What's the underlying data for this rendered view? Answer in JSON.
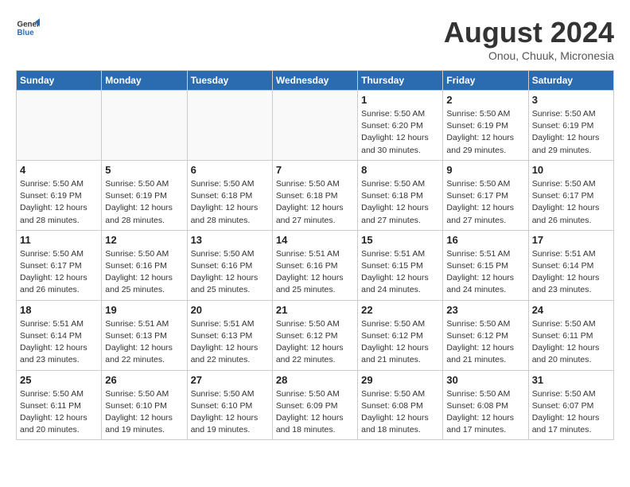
{
  "header": {
    "logo_line1": "General",
    "logo_line2": "Blue",
    "month_year": "August 2024",
    "location": "Onou, Chuuk, Micronesia"
  },
  "weekdays": [
    "Sunday",
    "Monday",
    "Tuesday",
    "Wednesday",
    "Thursday",
    "Friday",
    "Saturday"
  ],
  "weeks": [
    [
      {
        "day": "",
        "info": ""
      },
      {
        "day": "",
        "info": ""
      },
      {
        "day": "",
        "info": ""
      },
      {
        "day": "",
        "info": ""
      },
      {
        "day": "1",
        "info": "Sunrise: 5:50 AM\nSunset: 6:20 PM\nDaylight: 12 hours and 30 minutes."
      },
      {
        "day": "2",
        "info": "Sunrise: 5:50 AM\nSunset: 6:19 PM\nDaylight: 12 hours and 29 minutes."
      },
      {
        "day": "3",
        "info": "Sunrise: 5:50 AM\nSunset: 6:19 PM\nDaylight: 12 hours and 29 minutes."
      }
    ],
    [
      {
        "day": "4",
        "info": "Sunrise: 5:50 AM\nSunset: 6:19 PM\nDaylight: 12 hours and 28 minutes."
      },
      {
        "day": "5",
        "info": "Sunrise: 5:50 AM\nSunset: 6:19 PM\nDaylight: 12 hours and 28 minutes."
      },
      {
        "day": "6",
        "info": "Sunrise: 5:50 AM\nSunset: 6:18 PM\nDaylight: 12 hours and 28 minutes."
      },
      {
        "day": "7",
        "info": "Sunrise: 5:50 AM\nSunset: 6:18 PM\nDaylight: 12 hours and 27 minutes."
      },
      {
        "day": "8",
        "info": "Sunrise: 5:50 AM\nSunset: 6:18 PM\nDaylight: 12 hours and 27 minutes."
      },
      {
        "day": "9",
        "info": "Sunrise: 5:50 AM\nSunset: 6:17 PM\nDaylight: 12 hours and 27 minutes."
      },
      {
        "day": "10",
        "info": "Sunrise: 5:50 AM\nSunset: 6:17 PM\nDaylight: 12 hours and 26 minutes."
      }
    ],
    [
      {
        "day": "11",
        "info": "Sunrise: 5:50 AM\nSunset: 6:17 PM\nDaylight: 12 hours and 26 minutes."
      },
      {
        "day": "12",
        "info": "Sunrise: 5:50 AM\nSunset: 6:16 PM\nDaylight: 12 hours and 25 minutes."
      },
      {
        "day": "13",
        "info": "Sunrise: 5:50 AM\nSunset: 6:16 PM\nDaylight: 12 hours and 25 minutes."
      },
      {
        "day": "14",
        "info": "Sunrise: 5:51 AM\nSunset: 6:16 PM\nDaylight: 12 hours and 25 minutes."
      },
      {
        "day": "15",
        "info": "Sunrise: 5:51 AM\nSunset: 6:15 PM\nDaylight: 12 hours and 24 minutes."
      },
      {
        "day": "16",
        "info": "Sunrise: 5:51 AM\nSunset: 6:15 PM\nDaylight: 12 hours and 24 minutes."
      },
      {
        "day": "17",
        "info": "Sunrise: 5:51 AM\nSunset: 6:14 PM\nDaylight: 12 hours and 23 minutes."
      }
    ],
    [
      {
        "day": "18",
        "info": "Sunrise: 5:51 AM\nSunset: 6:14 PM\nDaylight: 12 hours and 23 minutes."
      },
      {
        "day": "19",
        "info": "Sunrise: 5:51 AM\nSunset: 6:13 PM\nDaylight: 12 hours and 22 minutes."
      },
      {
        "day": "20",
        "info": "Sunrise: 5:51 AM\nSunset: 6:13 PM\nDaylight: 12 hours and 22 minutes."
      },
      {
        "day": "21",
        "info": "Sunrise: 5:50 AM\nSunset: 6:12 PM\nDaylight: 12 hours and 22 minutes."
      },
      {
        "day": "22",
        "info": "Sunrise: 5:50 AM\nSunset: 6:12 PM\nDaylight: 12 hours and 21 minutes."
      },
      {
        "day": "23",
        "info": "Sunrise: 5:50 AM\nSunset: 6:12 PM\nDaylight: 12 hours and 21 minutes."
      },
      {
        "day": "24",
        "info": "Sunrise: 5:50 AM\nSunset: 6:11 PM\nDaylight: 12 hours and 20 minutes."
      }
    ],
    [
      {
        "day": "25",
        "info": "Sunrise: 5:50 AM\nSunset: 6:11 PM\nDaylight: 12 hours and 20 minutes."
      },
      {
        "day": "26",
        "info": "Sunrise: 5:50 AM\nSunset: 6:10 PM\nDaylight: 12 hours and 19 minutes."
      },
      {
        "day": "27",
        "info": "Sunrise: 5:50 AM\nSunset: 6:10 PM\nDaylight: 12 hours and 19 minutes."
      },
      {
        "day": "28",
        "info": "Sunrise: 5:50 AM\nSunset: 6:09 PM\nDaylight: 12 hours and 18 minutes."
      },
      {
        "day": "29",
        "info": "Sunrise: 5:50 AM\nSunset: 6:08 PM\nDaylight: 12 hours and 18 minutes."
      },
      {
        "day": "30",
        "info": "Sunrise: 5:50 AM\nSunset: 6:08 PM\nDaylight: 12 hours and 17 minutes."
      },
      {
        "day": "31",
        "info": "Sunrise: 5:50 AM\nSunset: 6:07 PM\nDaylight: 12 hours and 17 minutes."
      }
    ]
  ]
}
